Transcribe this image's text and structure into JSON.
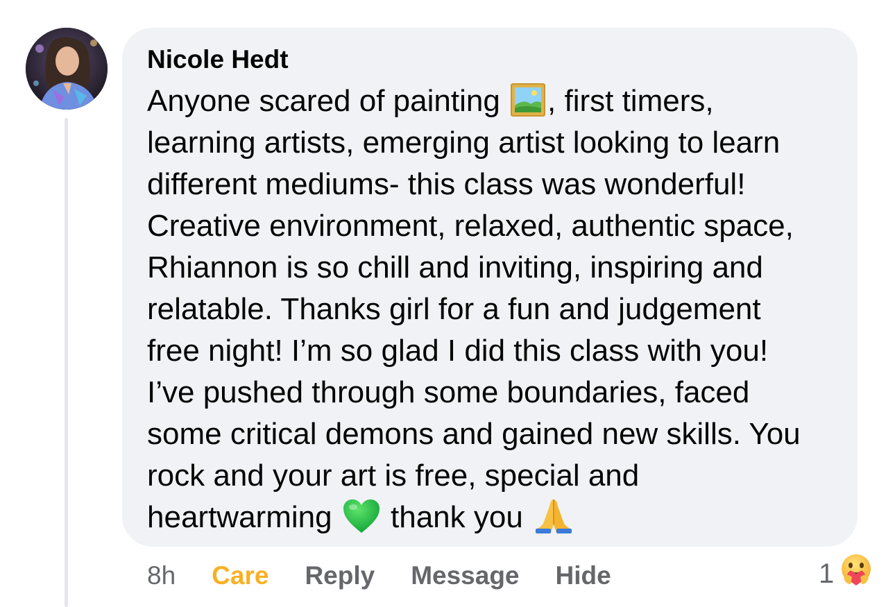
{
  "comment": {
    "author": "Nicole Hedt",
    "lines": [
      [
        "Anyone scared of painting ",
        ", first timers,"
      ],
      [
        "learning artists, emerging artist looking to learn"
      ],
      [
        "different mediums- this class was wonderful!"
      ],
      [
        "Creative environment, relaxed, authentic space,"
      ],
      [
        "Rhiannon is so chill and inviting, inspiring and"
      ],
      [
        "relatable. Thanks girl for a fun and judgement"
      ],
      [
        "free night! I’m so glad I did this class with you!"
      ],
      [
        "I’ve pushed through some boundaries, faced"
      ],
      [
        "some critical demons and gained new skills. You"
      ],
      [
        "rock and your art is free, special and"
      ],
      [
        "heartwarming ",
        " thank you "
      ]
    ],
    "emojis": [
      "framed-picture",
      "green-heart",
      "folded-hands"
    ]
  },
  "actions": {
    "time": "8h",
    "care": "Care",
    "reply": "Reply",
    "message": "Message",
    "hide": "Hide"
  },
  "reactions": {
    "count": "1",
    "icon": "care-reaction-icon"
  },
  "colors": {
    "bubble": "#f0f2f5",
    "care": "#f7b125",
    "muted": "#65676b",
    "text": "#050505"
  }
}
